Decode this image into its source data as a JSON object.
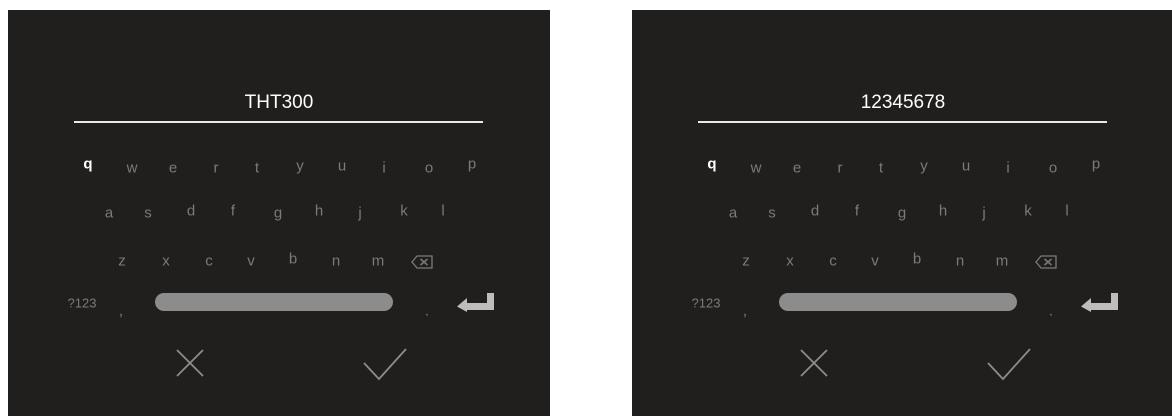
{
  "panels": [
    {
      "entry_text": "THT300",
      "keys": {
        "row1": [
          "q",
          "w",
          "e",
          "r",
          "t",
          "y",
          "u",
          "i",
          "o",
          "p"
        ],
        "row2": [
          "a",
          "s",
          "d",
          "f",
          "g",
          "h",
          "j",
          "k",
          "l"
        ],
        "row3": [
          "z",
          "x",
          "c",
          "v",
          "b",
          "n",
          "m"
        ],
        "mode_key": "?123",
        "comma_key": ",",
        "period_key": "."
      },
      "active_key": "q"
    },
    {
      "entry_text": "12345678",
      "keys": {
        "row1": [
          "q",
          "w",
          "e",
          "r",
          "t",
          "y",
          "u",
          "i",
          "o",
          "p"
        ],
        "row2": [
          "a",
          "s",
          "d",
          "f",
          "g",
          "h",
          "j",
          "k",
          "l"
        ],
        "row3": [
          "z",
          "x",
          "c",
          "v",
          "b",
          "n",
          "m"
        ],
        "mode_key": "?123",
        "comma_key": ",",
        "period_key": "."
      },
      "active_key": "q"
    }
  ],
  "icons": {
    "backspace": "backspace-icon",
    "enter": "enter-icon",
    "cancel": "close-icon",
    "confirm": "check-icon"
  },
  "colors": {
    "background": "#211f1d",
    "active_key": "#ffffff",
    "inactive_key": "#7a7a7a",
    "space_bar": "#8c8c8c"
  }
}
